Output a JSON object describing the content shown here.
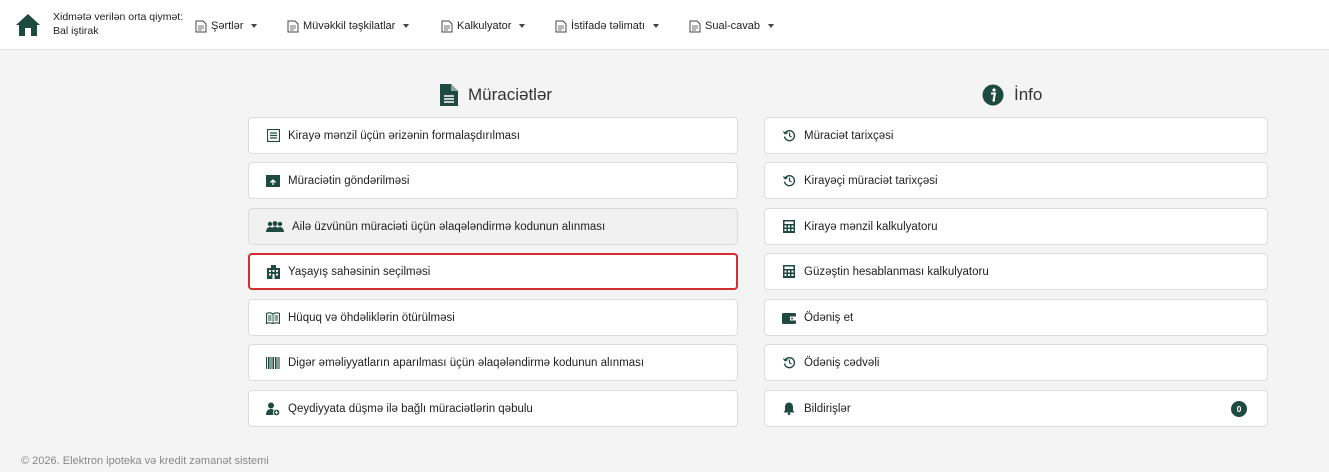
{
  "header": {
    "service_price_line1": "Xidmətə verilən orta qiymət:",
    "service_price_line2": "Bal iştirak",
    "nav": [
      {
        "label": "Şərtlər"
      },
      {
        "label": "Müvəkkil təşkilatlar"
      },
      {
        "label": "Kalkulyator"
      },
      {
        "label": "İstifadə təlimatı"
      },
      {
        "label": "Sual-cavab"
      }
    ]
  },
  "applications": {
    "title": "Müraciətlər",
    "items": [
      {
        "label": "Kirayə mənzil üçün ərizənin formalaşdırılması",
        "icon": "form-icon"
      },
      {
        "label": "Müraciətin göndərilməsi",
        "icon": "send-box-icon"
      },
      {
        "label": "Ailə üzvünün müraciəti üçün əlaqələndirmə kodunun alınması",
        "icon": "family-icon"
      },
      {
        "label": "Yaşayış sahəsinin seçilməsi",
        "icon": "building-icon"
      },
      {
        "label": "Hüquq və öhdəliklərin ötürülməsi",
        "icon": "book-icon"
      },
      {
        "label": "Digər əməliyyatların aparılması üçün əlaqələndirmə kodunun alınması",
        "icon": "barcode-icon"
      },
      {
        "label": "Qeydiyyata düşmə ilə bağlı müraciətlərin qəbulu",
        "icon": "user-add-icon"
      }
    ]
  },
  "info": {
    "title": "İnfo",
    "items": [
      {
        "label": "Müraciət tarixçəsi",
        "icon": "history-icon"
      },
      {
        "label": "Kirayəçi müraciət tarixçəsi",
        "icon": "history-icon"
      },
      {
        "label": "Kirayə mənzil kalkulyatoru",
        "icon": "calculator-icon"
      },
      {
        "label": "Güzəştin hesablanması kalkulyatoru",
        "icon": "calculator-icon"
      },
      {
        "label": "Ödəniş et",
        "icon": "wallet-icon"
      },
      {
        "label": "Ödəniş cədvəli",
        "icon": "history-icon"
      },
      {
        "label": "Bildirişlər",
        "icon": "bell-icon",
        "badge": "0"
      }
    ]
  },
  "footer": {
    "text": "© 2026. Elektron ipoteka və kredit zəmanət sistemi"
  },
  "colors": {
    "accent": "#1f4a3f",
    "selected_border": "#d32f2f"
  }
}
